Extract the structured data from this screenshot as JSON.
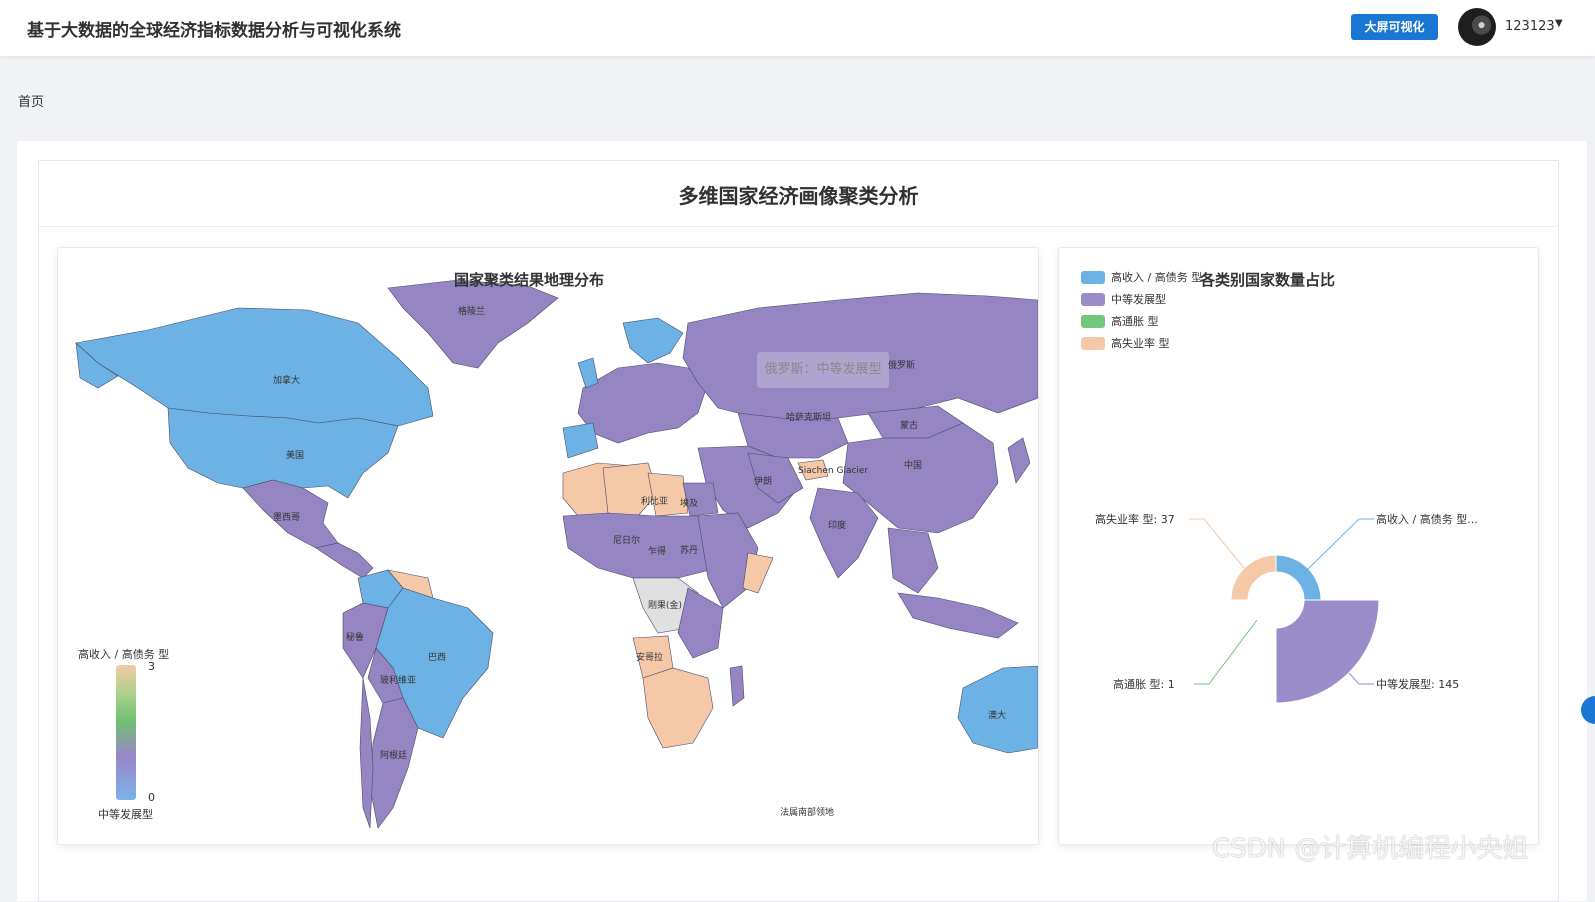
{
  "header": {
    "title": "基于大数据的全球经济指标数据分析与可视化系统",
    "screen_button": "大屏可视化",
    "username": "123123"
  },
  "breadcrumb": "首页",
  "section": {
    "title": "多维国家经济画像聚类分析"
  },
  "map": {
    "title": "国家聚类结果地理分布",
    "tooltip": "俄罗斯：中等发展型",
    "visual_map": {
      "top_label": "高收入 / 高债务 型",
      "bottom_label": "中等发展型",
      "max": "3",
      "min": "0"
    },
    "country_labels": {
      "canada": "加拿大",
      "usa": "美国",
      "greenland": "格陵兰",
      "russia": "俄罗斯",
      "china": "中国",
      "mongolia": "蒙古",
      "kazakhstan": "哈萨克斯坦",
      "brazil": "巴西",
      "india": "印度",
      "iran": "伊朗",
      "mexico": "墨西哥",
      "peru": "秘鲁",
      "bolivia": "玻利维亚",
      "argentina": "阿根廷",
      "egypt": "埃及",
      "libya": "利比亚",
      "niger": "尼日尔",
      "chad": "乍得",
      "sudan": "苏丹",
      "dr_congo": "刚果(金)",
      "angola": "安哥拉",
      "australia": "澳大",
      "glacier": "Siachen Glacier",
      "antarctica": "法属南部领地"
    },
    "colors": {
      "high_income": "#6cb2e4",
      "medium": "#9585c3",
      "high_inflation": "#72c77b",
      "high_unemployment": "#f5c9a8",
      "no_data": "#e0e0e0",
      "ocean": "#ffffff"
    }
  },
  "pie": {
    "title": "各类别国家数量占比",
    "legend": [
      {
        "name": "高收入 / 高债务 型",
        "color": "#6cb2e4"
      },
      {
        "name": "中等发展型",
        "color": "#9a8cc9"
      },
      {
        "name": "高通胀 型",
        "color": "#72c77b"
      },
      {
        "name": "高失业率 型",
        "color": "#f5c9a8"
      }
    ],
    "labels": {
      "high_income": "高收入 / 高债务 型...",
      "medium": "中等发展型: 145",
      "inflation": "高通胀 型: 1",
      "unemployment": "高失业率 型: 37"
    }
  },
  "chart_data": {
    "type": "pie",
    "title": "各类别国家数量占比",
    "style": "rose",
    "categories": [
      "高收入 / 高债务 型",
      "中等发展型",
      "高通胀 型",
      "高失业率 型"
    ],
    "values": [
      null,
      145,
      1,
      37
    ],
    "legend_position": "top-left"
  },
  "watermark": "CSDN @计算机编程小央姐"
}
